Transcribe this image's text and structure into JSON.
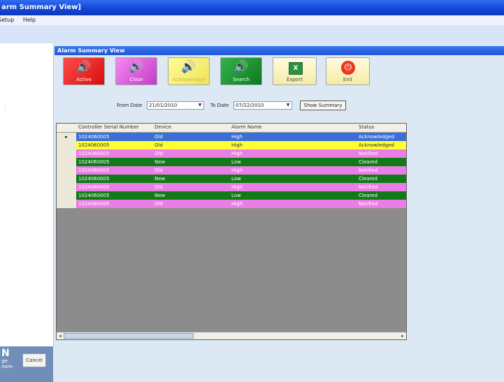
{
  "window": {
    "title": "arm Summary View]"
  },
  "menu": {
    "items": [
      "Setup",
      "Help"
    ]
  },
  "inner_title": "Alarm Summary View",
  "toolbar": {
    "buttons": [
      {
        "label": "Active",
        "icon": "speaker-icon",
        "color": "#e11b1b"
      },
      {
        "label": "Close",
        "icon": "speaker-icon",
        "color": "#d24fd4"
      },
      {
        "label": "Acknowledge",
        "icon": "speaker-icon",
        "color": "#f5ee75"
      },
      {
        "label": "Search",
        "icon": "speaker-icon",
        "color": "#1f9434"
      },
      {
        "label": "Export",
        "icon": "excel-icon",
        "glyph": "X"
      },
      {
        "label": "Exit",
        "icon": "power-icon",
        "glyph": "⏻"
      }
    ]
  },
  "filter": {
    "from_label": "From Date",
    "from_value": "21/01/2010",
    "to_label": "To Date",
    "to_value": "07/22/2010",
    "button": "Show Summary"
  },
  "grid": {
    "columns": [
      "Controller Serial Number",
      "Device",
      "Alarm Name",
      "Status"
    ],
    "rows": [
      {
        "serial": "1024060005",
        "device": "Old",
        "alarm": "High",
        "status": "Acknowledged",
        "color": "#3a6fd8",
        "selected": true
      },
      {
        "serial": "1024060005",
        "device": "Old",
        "alarm": "High",
        "status": "Acknowledged",
        "color": "#ffff33",
        "selected": false
      },
      {
        "serial": "1024060005",
        "device": "Old",
        "alarm": "High",
        "status": "Notified",
        "color": "#ea7ee6",
        "selected": false
      },
      {
        "serial": "1024060005",
        "device": "New",
        "alarm": "Low",
        "status": "Cleared",
        "color": "#107a17",
        "selected": false
      },
      {
        "serial": "1024060005",
        "device": "Old",
        "alarm": "High",
        "status": "Notified",
        "color": "#ea7ee6",
        "selected": false
      },
      {
        "serial": "1024060005",
        "device": "New",
        "alarm": "Low",
        "status": "Cleared",
        "color": "#107a17",
        "selected": false
      },
      {
        "serial": "1024060005",
        "device": "Old",
        "alarm": "High",
        "status": "Notified",
        "color": "#ea7ee6",
        "selected": false
      },
      {
        "serial": "1024060005",
        "device": "New",
        "alarm": "Low",
        "status": "Cleared",
        "color": "#107a17",
        "selected": false
      },
      {
        "serial": "1024060005",
        "device": "Old",
        "alarm": "High",
        "status": "Notified",
        "color": "#ea7ee6",
        "selected": false
      }
    ]
  },
  "left": {
    "brand_letter": "N",
    "brand_line1": "ge",
    "brand_line2": "nore",
    "cancel_label": "Cancel"
  }
}
